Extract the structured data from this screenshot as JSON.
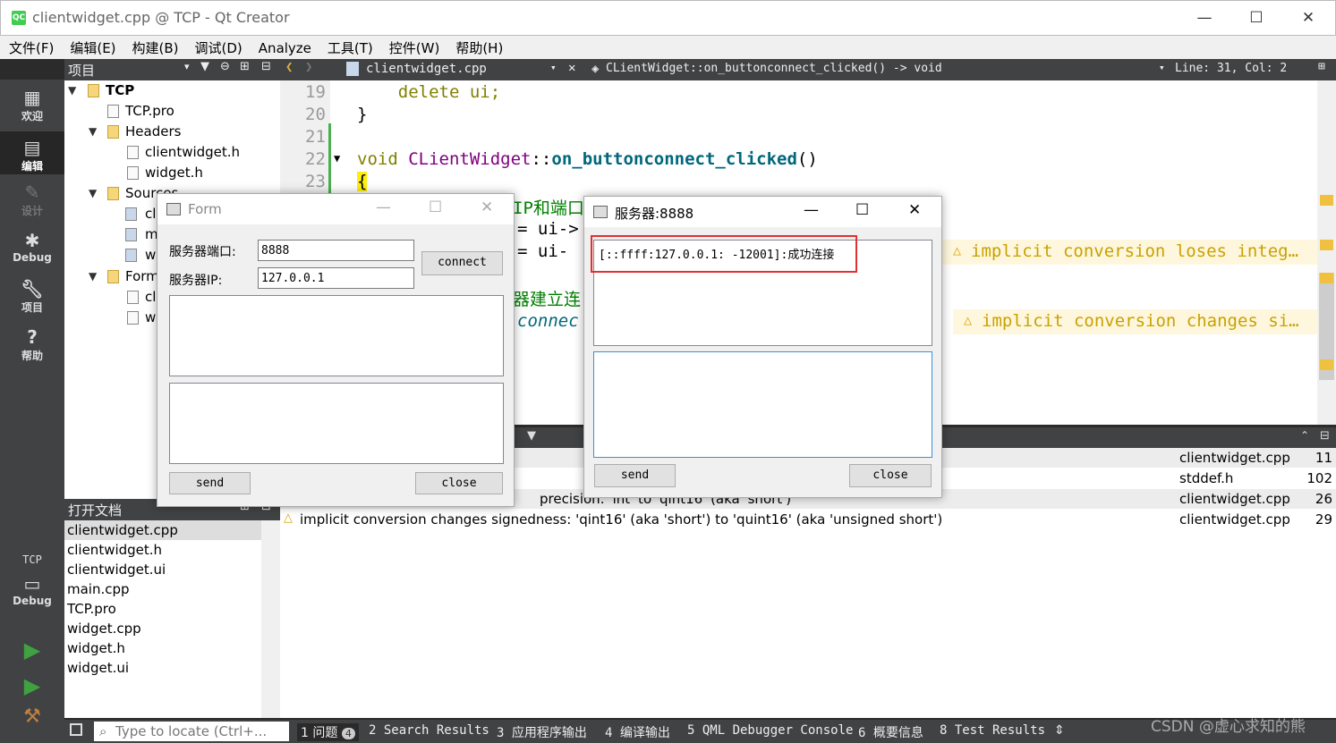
{
  "window": {
    "title": "clientwidget.cpp @ TCP - Qt Creator",
    "logo": "QC",
    "minimize": "—",
    "maximize": "☐",
    "close": "✕"
  },
  "menu": [
    "文件(F)",
    "编辑(E)",
    "构建(B)",
    "调试(D)",
    "Analyze",
    "工具(T)",
    "控件(W)",
    "帮助(H)"
  ],
  "modes": [
    {
      "label": "欢迎",
      "icon": "grid-icon"
    },
    {
      "label": "编辑",
      "icon": "edit-icon"
    },
    {
      "label": "设计",
      "icon": "pencil-icon"
    },
    {
      "label": "Debug",
      "icon": "bug-icon"
    },
    {
      "label": "项目",
      "icon": "wrench-icon"
    },
    {
      "label": "帮助",
      "icon": "help-icon"
    }
  ],
  "kit": {
    "project": "TCP",
    "config": "Debug"
  },
  "project_panel": {
    "title": "项目",
    "tree": {
      "root": "TCP",
      "pro": "TCP.pro",
      "headers": "Headers",
      "header_files": [
        "clientwidget.h",
        "widget.h"
      ],
      "sources": "Sources",
      "source_partial": [
        "cl",
        "m",
        "w"
      ],
      "forms": "Form",
      "form_partial": [
        "cl",
        "w"
      ]
    }
  },
  "open_docs": {
    "title": "打开文档",
    "items": [
      "clientwidget.cpp",
      "clientwidget.h",
      "clientwidget.ui",
      "main.cpp",
      "TCP.pro",
      "widget.cpp",
      "widget.h",
      "widget.ui"
    ]
  },
  "editor": {
    "file": "clientwidget.cpp",
    "function": "CLientWidget::on_buttonconnect_clicked() -> void",
    "position": "Line: 31, Col: 2",
    "lines": [
      {
        "n": "19",
        "code": "    delete ui;"
      },
      {
        "n": "20",
        "code": "}"
      },
      {
        "n": "21",
        "code": ""
      },
      {
        "n": "22",
        "kw": "void ",
        "cls": "CLientWidget",
        "sep": "::",
        "fn": "on_buttonconnect_clicked",
        "tail": "()"
      },
      {
        "n": "23",
        "code": "{"
      }
    ],
    "partial_1": "IP和端口",
    "partial_2": "= ui->",
    "partial_3": "= ui-",
    "partial_4": "器建立连",
    "partial_5": "connec",
    "warning_1": "implicit conversion loses integ…",
    "warning_2": "implicit conversion changes si…"
  },
  "issues": [
    {
      "text": "",
      "file": "clientwidget.cpp",
      "line": "11"
    },
    {
      "text": "",
      "file": "stddef.h",
      "line": "102"
    },
    {
      "text": "precision: 'int' to 'qint16' (aka 'short')",
      "file": "clientwidget.cpp",
      "line": "26"
    },
    {
      "text": "implicit conversion changes signedness: 'qint16' (aka 'short') to 'quint16' (aka 'unsigned short')",
      "file": "clientwidget.cpp",
      "line": "29"
    }
  ],
  "statusbar": {
    "locate_placeholder": "Type to locate (Ctrl+...",
    "tabs": [
      "1 问题",
      "2 Search Results",
      "3 应用程序输出",
      "4 编译输出",
      "5 QML Debugger Console",
      "6 概要信息",
      "8 Test Results"
    ],
    "issue_count": "4"
  },
  "client_form": {
    "title": "Form",
    "port_label": "服务器端口:",
    "port_value": "8888",
    "ip_label": "服务器IP:",
    "ip_value": "127.0.0.1",
    "connect": "connect",
    "send": "send",
    "close": "close"
  },
  "server_form": {
    "title": "服务器:8888",
    "message": "[::ffff:127.0.0.1: -12001]:成功连接",
    "send": "send",
    "close": "close"
  },
  "watermark": "CSDN @虚心求知的熊"
}
